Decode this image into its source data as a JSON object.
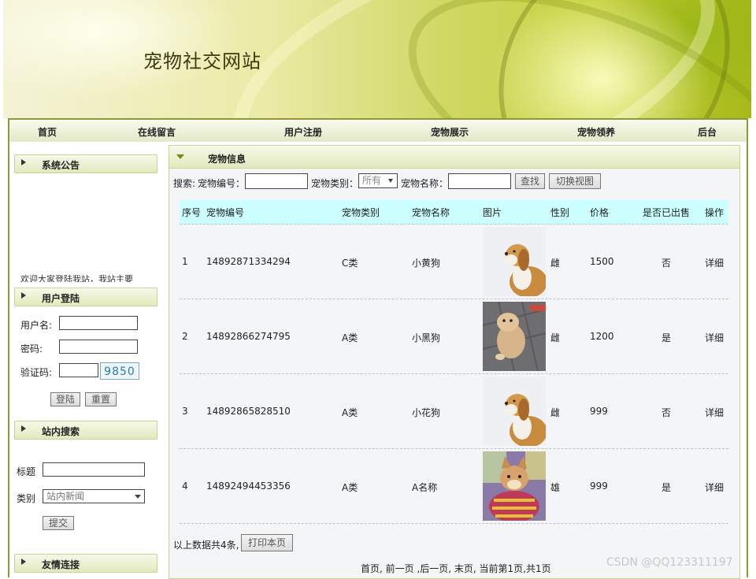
{
  "site": {
    "title": "宠物社交网站"
  },
  "nav": {
    "items": [
      "首页",
      "在线留言",
      "用户注册",
      "宠物展示",
      "宠物领养",
      "后台"
    ]
  },
  "sidebar": {
    "notice": {
      "title": "系统公告",
      "text": "欢迎大家登陆我站，我站主要"
    },
    "login": {
      "title": "用户登陆",
      "username_label": "用户名:",
      "password_label": "密码:",
      "captcha_label": "验证码:",
      "captcha_value": "9850",
      "login_button": "登陆",
      "reset_button": "重置"
    },
    "search": {
      "title": "站内搜索",
      "title_label": "标题",
      "category_label": "类别",
      "category_value": "站内新闻",
      "submit_button": "提交"
    },
    "links": {
      "title": "友情连接"
    }
  },
  "main": {
    "title": "宠物信息",
    "search_bar": {
      "prefix": "搜索:",
      "id_label": "宠物编号：",
      "category_label": "宠物类别：",
      "category_value": "所有",
      "name_label": "宠物名称：",
      "find_button": "查找",
      "toggle_button": "切换视图"
    },
    "table": {
      "headers": [
        "序号",
        "宠物编号",
        "宠物类别",
        "宠物名称",
        "图片",
        "性别",
        "价格",
        "是否已出售",
        "操作"
      ],
      "rows": [
        {
          "index": "1",
          "id": "14892871334294",
          "category": "C类",
          "name": "小黄狗",
          "image": "beagle-photo",
          "sex": "雌",
          "price": "1500",
          "sold": "否",
          "action": "详细"
        },
        {
          "index": "2",
          "id": "14892866274795",
          "category": "A类",
          "name": "小黑狗",
          "image": "pomeranian-photo",
          "sex": "雌",
          "price": "1200",
          "sold": "是",
          "action": "详细"
        },
        {
          "index": "3",
          "id": "14892865828510",
          "category": "A类",
          "name": "小花狗",
          "image": "beagle-photo",
          "sex": "雌",
          "price": "999",
          "sold": "否",
          "action": "详细"
        },
        {
          "index": "4",
          "id": "14892494453356",
          "category": "A类",
          "name": "A名称",
          "image": "shiba-sweater-photo",
          "sex": "雄",
          "price": "999",
          "sold": "是",
          "action": "详细"
        }
      ]
    },
    "summary": "以上数据共4条,",
    "print_button": "打印本页",
    "pager": "首页, 前一页 ,后一页, 末页, 当前第1页,共1页"
  },
  "watermark": "CSDN @QQ123311197",
  "colors": {
    "nav_border": "#8a9a3a",
    "table_header_bg": "#ccffff",
    "panel_bg": "#f3f5f7"
  }
}
